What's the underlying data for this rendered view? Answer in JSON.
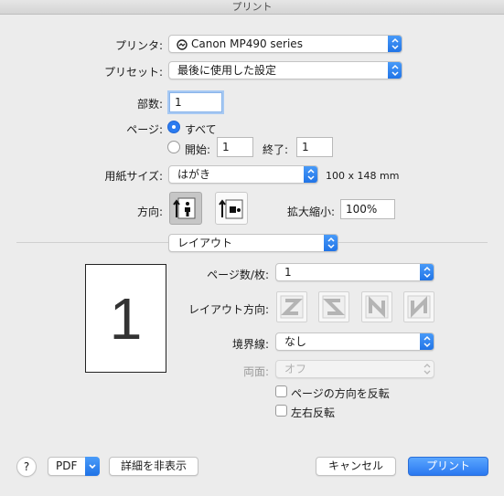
{
  "window": {
    "title": "プリント"
  },
  "printer": {
    "label": "プリンタ:",
    "value": "Canon MP490 series"
  },
  "preset": {
    "label": "プリセット:",
    "value": "最後に使用した設定"
  },
  "copies": {
    "label": "部数:",
    "value": "1"
  },
  "pages": {
    "label": "ページ:",
    "all_label": "すべて",
    "range_label": "開始:",
    "from_value": "1",
    "to_label": "終了:",
    "to_value": "1"
  },
  "paper": {
    "label": "用紙サイズ:",
    "value": "はがき",
    "dimensions": "100 x 148 mm"
  },
  "orientation": {
    "label": "方向:",
    "portrait_icon": "portrait-orientation-icon",
    "landscape_icon": "landscape-orientation-icon"
  },
  "scale": {
    "label": "拡大縮小:",
    "value": "100%"
  },
  "section": {
    "value": "レイアウト"
  },
  "preview": {
    "page_number": "1"
  },
  "layout": {
    "pages_per_sheet_label": "ページ数/枚:",
    "pages_per_sheet_value": "1",
    "direction_label": "レイアウト方向:",
    "direction_icons": [
      "z-layout-icon",
      "reverse-z-layout-icon",
      "n-layout-icon",
      "reverse-n-layout-icon"
    ],
    "border_label": "境界線:",
    "border_value": "なし",
    "two_sided_label": "両面:",
    "two_sided_value": "オフ",
    "reverse_orientation_label": "ページの方向を反転",
    "reverse_orientation_checked": false,
    "flip_horizontal_label": "左右反転",
    "flip_horizontal_checked": false
  },
  "footer": {
    "help_label": "?",
    "pdf_label": "PDF",
    "hide_details_label": "詳細を非表示",
    "cancel_label": "キャンセル",
    "print_label": "プリント"
  },
  "colors": {
    "accent": "#2b7bf0",
    "window_bg": "#ececec"
  }
}
